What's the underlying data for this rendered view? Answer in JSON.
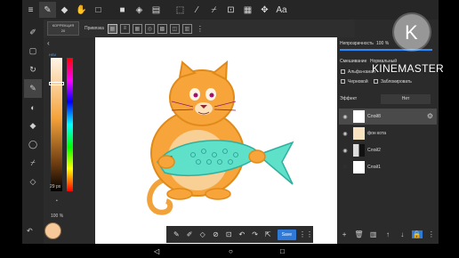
{
  "toolbar": {
    "icons": [
      "menu-icon",
      "pen-icon",
      "eraser-icon",
      "hand-icon",
      "select-rect-icon",
      "fill-rect-icon",
      "bucket-icon",
      "gradient-icon",
      "lasso-icon",
      "wand-icon",
      "eyedropper-icon",
      "transform-icon",
      "layer-select-icon",
      "move-icon",
      "text-icon"
    ],
    "text_tool": "Aa"
  },
  "subbar": {
    "correction_label": "КОРРЕКЦИЯ",
    "correction_value": "20",
    "snap_label": "Привязка"
  },
  "color_panel": {
    "mode": "HSV",
    "brush_size": "29 px",
    "opacity": "100 %"
  },
  "right_panel": {
    "opacity_label": "Непрозрачность",
    "opacity_value": "100 %",
    "blend_label": "Смешивание",
    "blend_value": "Нормальный",
    "alpha_lock_label": "Альфа-канал",
    "draft_label": "Черновой",
    "lock_label": "Заблокировать",
    "effect_label": "Эффект",
    "effect_value": "Нет",
    "layers": [
      {
        "name": "Слой8",
        "visible": true,
        "selected": true
      },
      {
        "name": "фон кота",
        "visible": true,
        "selected": false
      },
      {
        "name": "Слой2",
        "visible": true,
        "selected": false
      },
      {
        "name": "Слой1",
        "visible": false,
        "selected": false
      }
    ]
  },
  "bottom_toolbar": {
    "save_label": "Save"
  },
  "watermark": {
    "text": "KINEMASTER"
  },
  "colors": {
    "accent": "#2f7ad8",
    "current_color": "#f7c998"
  }
}
